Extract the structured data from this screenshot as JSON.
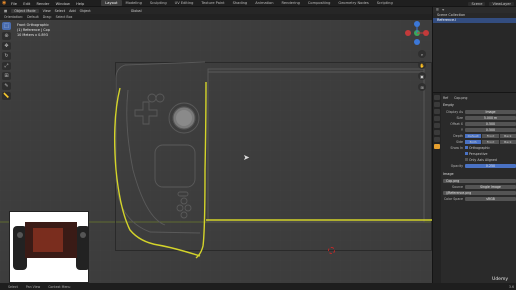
{
  "menu": [
    "File",
    "Edit",
    "Render",
    "Window",
    "Help"
  ],
  "workspace_tabs": [
    "Layout",
    "Modeling",
    "Sculpting",
    "UV Editing",
    "Texture Paint",
    "Shading",
    "Animation",
    "Rendering",
    "Compositing",
    "Geometry Nodes",
    "Scripting"
  ],
  "active_tab": "Layout",
  "scene": "Scene",
  "view_layer": "ViewLayer",
  "header": {
    "mode": "Object Mode",
    "menus": [
      "View",
      "Select",
      "Add",
      "Object"
    ],
    "orientation_label": "Orientation:",
    "orientation": "Default",
    "drag_label": "Drag:",
    "drag": "Select Box",
    "transform": "Global"
  },
  "viewport_info": {
    "line1": "Front Orthographic",
    "line2": "(1) Reference | Cop",
    "line3": "10 Meters x 0.893"
  },
  "outliner": {
    "rows": [
      "Scene Collection",
      "Reference.i"
    ]
  },
  "properties": {
    "object_name": "Ref",
    "data_name": "Cop.png",
    "section_empty": "Empty",
    "display_as_label": "Display As",
    "display_as": "Image",
    "size_label": "Size",
    "size": "5.000 m",
    "offset_x_label": "Offset X",
    "offset_x": "0.500",
    "offset_y_label": "Y",
    "offset_y": "0.500",
    "depth_label": "Depth",
    "depth_opts": [
      "Default",
      "Front",
      "Back"
    ],
    "side_label": "Side",
    "side_opts": [
      "Both",
      "Front",
      "Back"
    ],
    "show_in_label": "Show In",
    "show_opts": [
      "Orthographic",
      "Perspective",
      "Only Axis Aligned"
    ],
    "opacity_label": "Opacity",
    "opacity": "0.250",
    "section_image": "Image",
    "image_file": "Cop.png",
    "source_label": "Source",
    "source": "Single Image",
    "filepath": "//Reference.png",
    "colorspace_label": "Color Space",
    "colorspace": "sRGB"
  },
  "status": [
    "Select",
    "Pan View",
    "Context Menu"
  ],
  "version": "3.6",
  "watermark": "Udemy"
}
